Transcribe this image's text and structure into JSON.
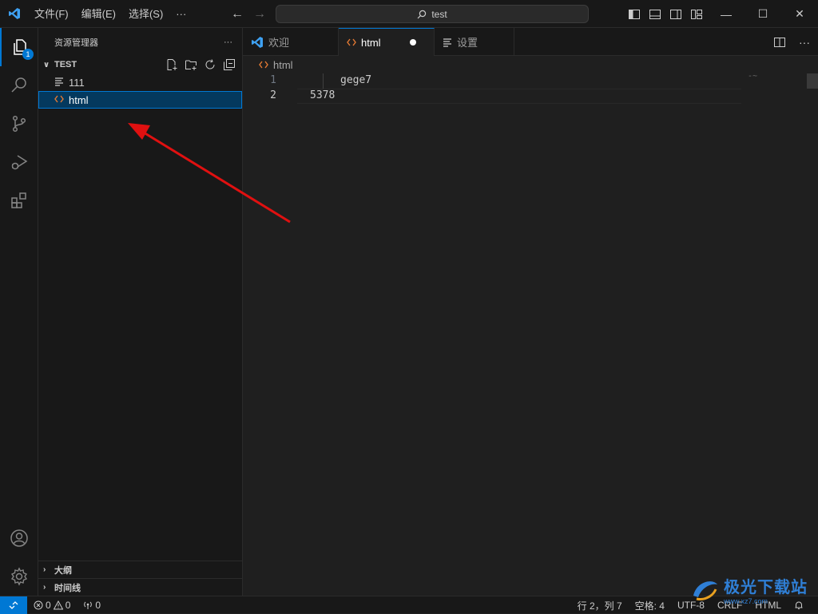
{
  "titlebar": {
    "menu": [
      "文件(F)",
      "编辑(E)",
      "选择(S)",
      "···"
    ],
    "search_text": "test"
  },
  "activity": {
    "explorer_badge": "1"
  },
  "sidebar": {
    "title": "资源管理器",
    "more": "···",
    "section": "TEST",
    "items": [
      {
        "icon": "text-file-icon",
        "label": "111"
      },
      {
        "icon": "html-file-icon",
        "label": "html"
      }
    ],
    "bottom_sections": [
      "大纲",
      "时间线"
    ]
  },
  "tabs": [
    {
      "label": "欢迎",
      "icon": "vscode-logo-icon"
    },
    {
      "label": "html",
      "icon": "html-file-icon",
      "modified": true
    },
    {
      "label": "设置",
      "icon": "settings-list-icon"
    }
  ],
  "breadcrumb": "html",
  "editor": {
    "lines": [
      {
        "number": "1",
        "text": "gege7"
      },
      {
        "number": "2",
        "text": "5378"
      }
    ],
    "minimap_hint": "-~"
  },
  "status": {
    "errors": "0",
    "warnings": "0",
    "ports": "0",
    "position": "行 2，列 7",
    "spaces": "空格: 4",
    "encoding": "UTF-8",
    "eol": "CRLF",
    "language": "HTML"
  },
  "watermark": {
    "text": "极光下载站",
    "sub": "www.xz7.com"
  },
  "colors": {
    "accent": "#0078d4",
    "arrow": "#e01010",
    "html_icon": "#e37933"
  }
}
